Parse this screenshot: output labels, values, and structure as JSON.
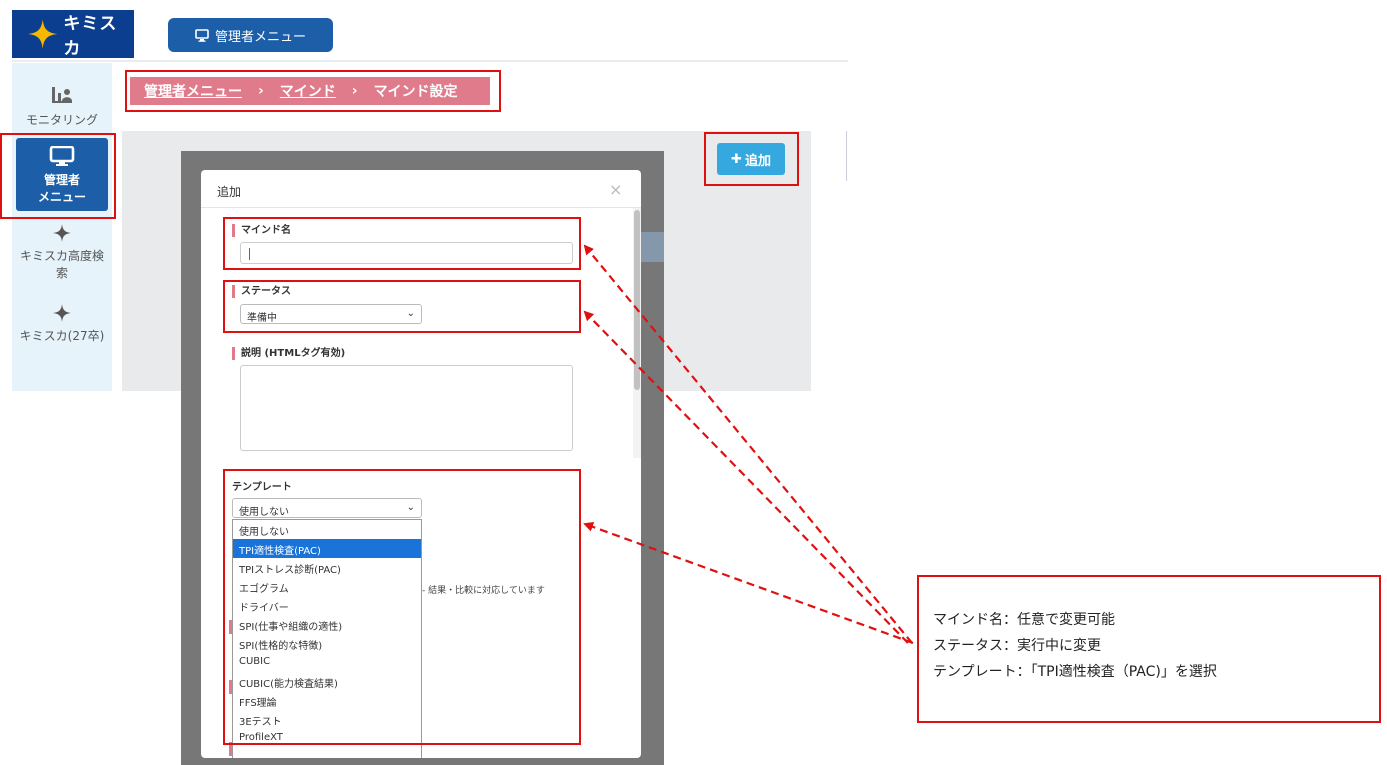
{
  "header": {
    "logo_text": "キミスカ",
    "admin_menu_button": "管理者メニュー"
  },
  "sidebar": {
    "items": [
      {
        "label": "モニタリング",
        "icon": "monitoring-chart-icon"
      },
      {
        "label_line1": "管理者",
        "label_line2": "メニュー",
        "icon": "monitor-icon",
        "active": true
      },
      {
        "label_line1": "キミスカ高度検",
        "label_line2": "索",
        "icon": "sparkle-icon"
      },
      {
        "label": "キミスカ(27卒)",
        "icon": "sparkle-icon"
      }
    ]
  },
  "breadcrumb": {
    "items": [
      "管理者メニュー",
      "マインド",
      "マインド設定"
    ],
    "separator": "›"
  },
  "add_button": {
    "label": "追加",
    "icon": "plus-icon"
  },
  "modal": {
    "title": "追加",
    "close": "×",
    "mind_name": {
      "label": "マインド名",
      "value": ""
    },
    "status": {
      "label": "ステータス",
      "selected": "準備中"
    },
    "description": {
      "label": "説明 (HTMLタグ有効)",
      "value": ""
    },
    "template": {
      "label": "テンプレート",
      "selected": "使用しない",
      "options": [
        "使用しない",
        "TPI適性検査(PAC)",
        "TPIストレス診断(PAC)",
        "エゴグラム",
        "ドライバー",
        "SPI(仕事や組織の適性)",
        "SPI(性格的な特徴)",
        "CUBIC",
        "CUBIC(能力検査結果)",
        "FFS理論",
        "3Eテスト",
        "ProfileXT"
      ],
      "highlighted_option": "TPI適性検査(PAC)"
    },
    "note_fragment": "- 結果・比較に対応しています"
  },
  "annotation": {
    "lines": [
      "マインド名：任意で変更可能",
      "ステータス：実行中に変更",
      "テンプレート：「TPI適性検査（PAC)」を選択"
    ]
  },
  "colors": {
    "brand_navy": "#0b3e8f",
    "primary_blue": "#1c5fa8",
    "accent_pink": "#e07b8c",
    "add_button_blue": "#35a8df",
    "highlight_red": "#e01010",
    "sidebar_bg": "#e6f3fa"
  }
}
